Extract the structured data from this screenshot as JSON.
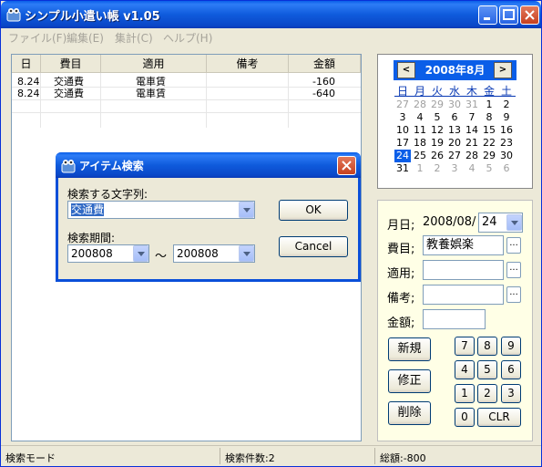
{
  "window": {
    "title": "シンプル小遣い帳 v1.05",
    "icon": "app-icon"
  },
  "menu": [
    "ファイル(F)",
    "編集(E)",
    "集計(C)",
    "ヘルプ(H)"
  ],
  "table": {
    "headers": [
      "日",
      "費目",
      "適用",
      "備考",
      "金額"
    ],
    "rows": [
      {
        "day": "8.24",
        "item": "交通費",
        "desc": "電車賃",
        "note": "",
        "amount": "-160"
      },
      {
        "day": "8.24",
        "item": "交通費",
        "desc": "電車賃",
        "note": "",
        "amount": "-640"
      }
    ]
  },
  "calendar": {
    "month_label": "2008年8月",
    "prev": "<",
    "next": ">",
    "weekdays": [
      "日",
      "月",
      "火",
      "水",
      "木",
      "金",
      "土"
    ],
    "weeks": [
      [
        "27",
        "28",
        "29",
        "30",
        "31",
        "1",
        "2"
      ],
      [
        "3",
        "4",
        "5",
        "6",
        "7",
        "8",
        "9"
      ],
      [
        "10",
        "11",
        "12",
        "13",
        "14",
        "15",
        "16"
      ],
      [
        "17",
        "18",
        "19",
        "20",
        "21",
        "22",
        "23"
      ],
      [
        "24",
        "25",
        "26",
        "27",
        "28",
        "29",
        "30"
      ],
      [
        "31",
        "1",
        "2",
        "3",
        "4",
        "5",
        "6"
      ]
    ],
    "selected": "24"
  },
  "entry": {
    "date_label": "月日;",
    "date_prefix": "2008/08/",
    "date_day": "24",
    "category_label": "費目;",
    "category_value": "教養娯楽",
    "desc_label": "適用;",
    "desc_value": "",
    "note_label": "備考;",
    "note_value": "",
    "amount_label": "金額;",
    "amount_value": "",
    "browse": "...",
    "btn_new": "新規",
    "btn_edit": "修正",
    "btn_delete": "削除",
    "keys": [
      "7",
      "8",
      "9",
      "4",
      "5",
      "6",
      "1",
      "2",
      "3",
      "0"
    ],
    "clr": "CLR"
  },
  "status": {
    "mode": "検索モード",
    "count": "検索件数:2",
    "total": "総額:-800"
  },
  "dialog": {
    "title": "アイテム検索",
    "search_label": "検索する文字列:",
    "search_value": "交通費",
    "period_label": "検索期間:",
    "from": "200808",
    "tilde": "〜",
    "to": "200808",
    "ok": "OK",
    "cancel": "Cancel"
  }
}
